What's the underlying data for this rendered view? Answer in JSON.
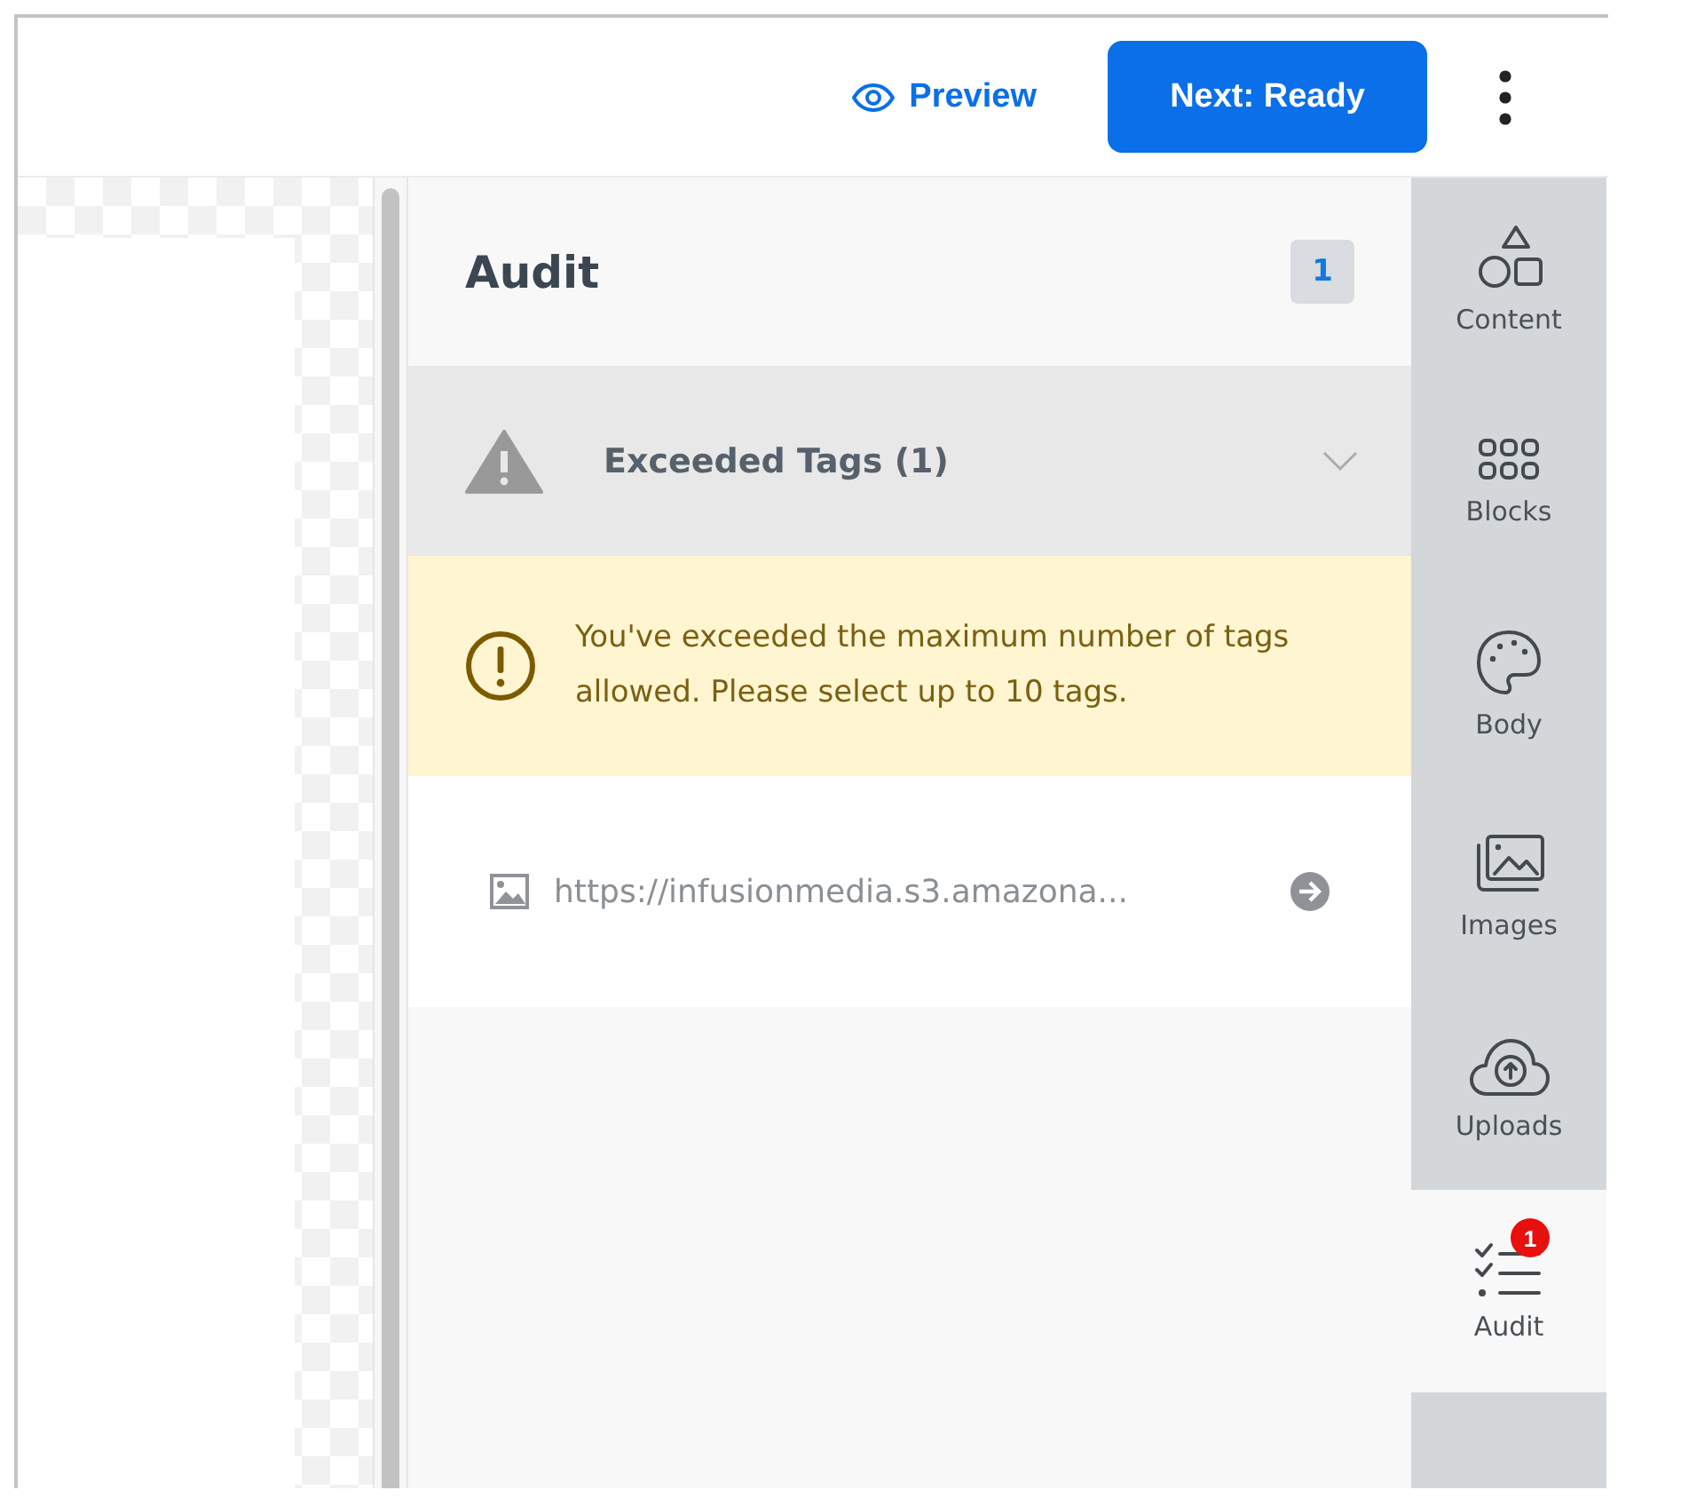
{
  "header": {
    "preview_label": "Preview",
    "next_label": "Next: Ready"
  },
  "audit": {
    "title": "Audit",
    "count": "1",
    "group": {
      "title": "Exceeded Tags (1)",
      "expanded": true
    },
    "alert": "You've exceeded the maximum number of tags allowed. Please select up to 10 tags.",
    "items": [
      {
        "url": "https://infusionmedia.s3.amazona..."
      }
    ]
  },
  "rail": [
    {
      "kind": "content",
      "label": "Content",
      "selected": false
    },
    {
      "kind": "blocks",
      "label": "Blocks",
      "selected": false
    },
    {
      "kind": "body",
      "label": "Body",
      "selected": false
    },
    {
      "kind": "images",
      "label": "Images",
      "selected": false
    },
    {
      "kind": "uploads",
      "label": "Uploads",
      "selected": false
    },
    {
      "kind": "audit",
      "label": "Audit",
      "selected": true,
      "badge": "1"
    }
  ]
}
